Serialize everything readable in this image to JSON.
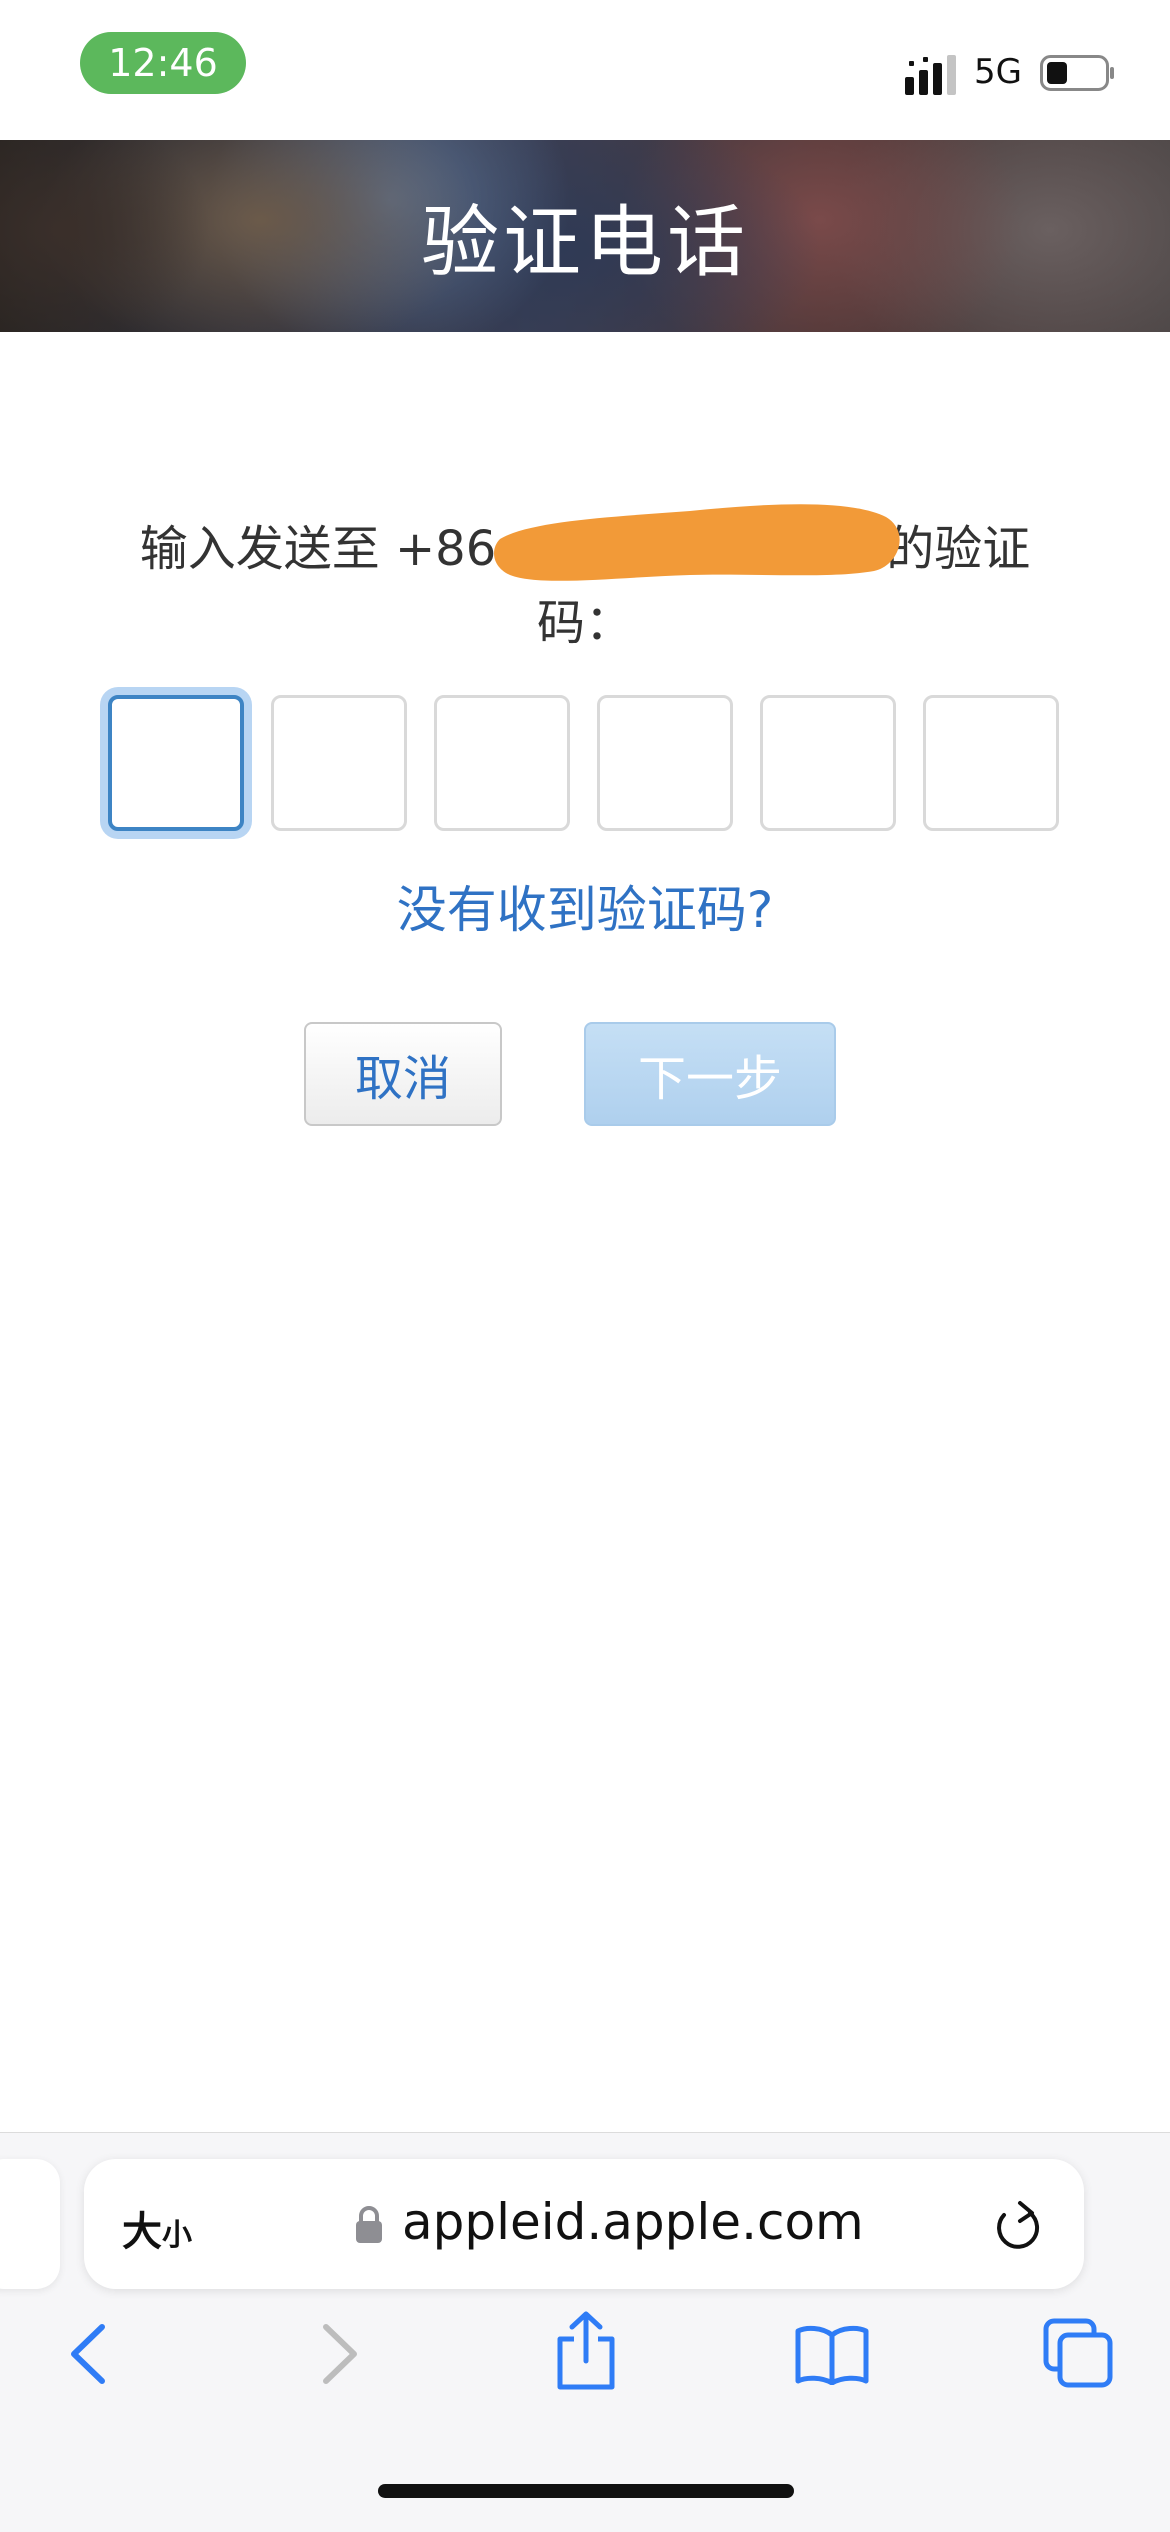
{
  "status_bar": {
    "time": "12:46",
    "network": "5G"
  },
  "header": {
    "title": "验证电话"
  },
  "verify": {
    "instruction_prefix": "输入发送至 +86",
    "instruction_suffix": "的验证码：",
    "code_length": 6,
    "code_values": [
      "",
      "",
      "",
      "",
      "",
      ""
    ],
    "resend_link": "没有收到验证码?"
  },
  "actions": {
    "cancel_label": "取消",
    "next_label": "下一步"
  },
  "browser": {
    "text_size_big": "大",
    "text_size_small": "小",
    "url": "appleid.apple.com"
  },
  "colors": {
    "accent": "#2f72c4",
    "focus_ring": "#b8d5f3",
    "time_pill": "#5cb85c",
    "redaction": "#f29a38",
    "next_disabled": "#c5dff5"
  }
}
